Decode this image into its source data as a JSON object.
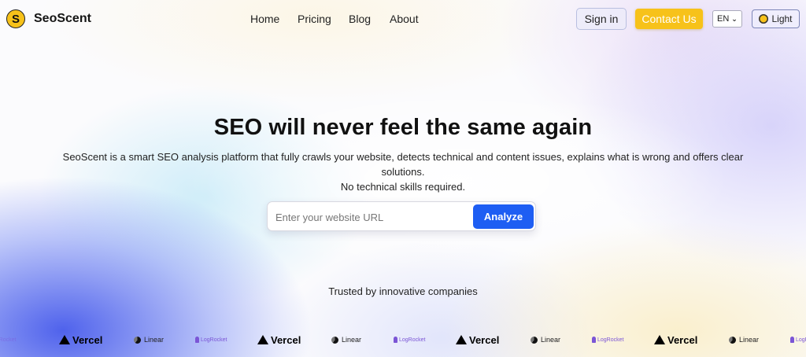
{
  "brand": {
    "initial": "S",
    "name": "SeoScent",
    "accent_color": "#f7c21a",
    "primary_button_color": "#1e5ef3"
  },
  "nav": {
    "items": [
      "Home",
      "Pricing",
      "Blog",
      "About"
    ]
  },
  "header_actions": {
    "signin_label": "Sign in",
    "contact_label": "Contact Us",
    "language_selected": "EN",
    "theme_label": "Light",
    "theme_icon": "sun-icon"
  },
  "hero": {
    "title": "SEO will never feel the same again",
    "description_line1": "SeoScent is a smart SEO analysis platform that fully crawls your website, detects technical and content issues, explains what is wrong and offers clear solutions.",
    "description_line2": "No technical skills required."
  },
  "search": {
    "placeholder": "Enter your website URL",
    "value": "",
    "button_label": "Analyze"
  },
  "trusted": {
    "label": "Trusted by innovative companies",
    "logos": [
      "Vercel",
      "Linear",
      "LogRocket"
    ]
  }
}
